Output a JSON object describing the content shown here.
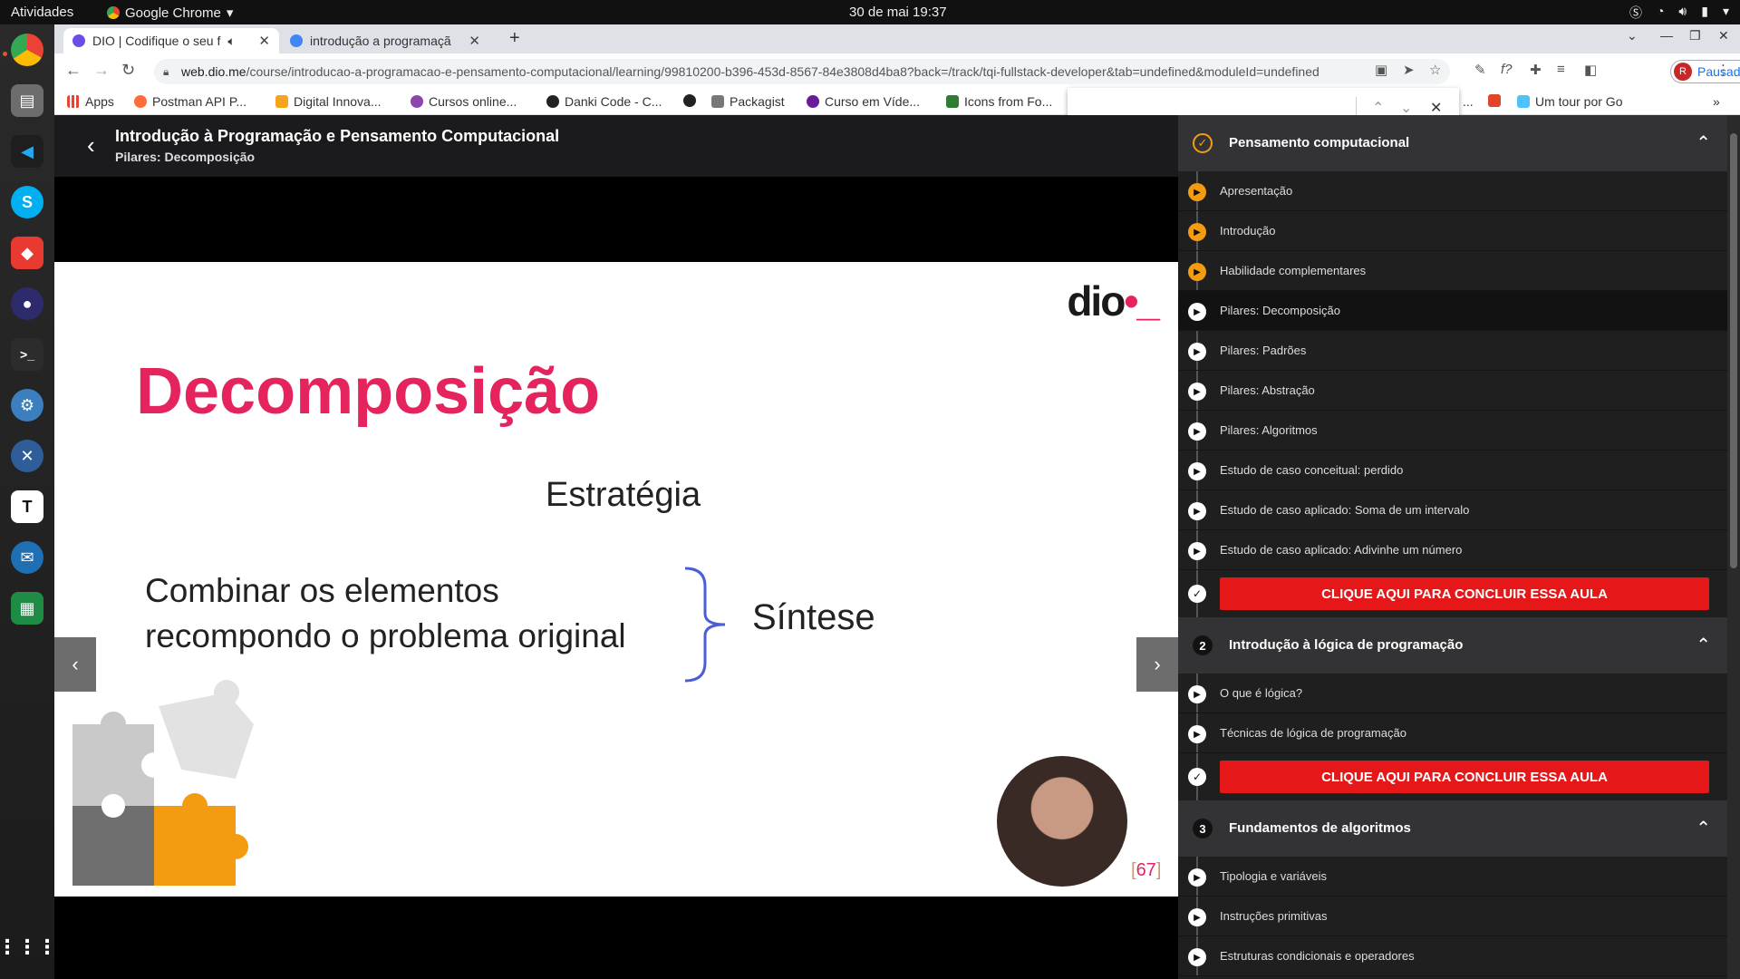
{
  "topbar": {
    "activities": "Atividades",
    "app_name": "Google Chrome",
    "clock": "30 de mai  19:37"
  },
  "tabs": [
    {
      "title": "DIO | Codifique o seu f",
      "favicon_color": "#6c4ee6"
    },
    {
      "title": "introdução a programaçã",
      "favicon_color": "#4285f4"
    }
  ],
  "toolbar": {
    "url_host": "web.dio.me",
    "url_path": "/course/introducao-a-programacao-e-pensamento-computacional/learning/99810200-b396-453d-8567-84e3808d4ba8?back=/track/tqi-fullstack-developer&tab=undefined&moduleId=undefined",
    "profile_initial": "R",
    "profile_label": "Pausada"
  },
  "bookmarks": [
    {
      "label": "Apps",
      "color": "#ea4335"
    },
    {
      "label": "Postman API P...",
      "color": "#ff6c37"
    },
    {
      "label": "Digital Innova...",
      "color": "#f7a41d"
    },
    {
      "label": "Cursos online...",
      "color": "#8e44ad"
    },
    {
      "label": "Danki Code - C...",
      "color": "#222222"
    },
    {
      "label": "",
      "color": "#222222"
    },
    {
      "label": "Packagist",
      "color": "#777777"
    },
    {
      "label": "Curso em Víde...",
      "color": "#6a1b9a"
    },
    {
      "label": "Icons from Fo...",
      "color": "#2e7d32"
    },
    {
      "label": "...",
      "color": "#ffffff"
    },
    {
      "label": "",
      "color": "#e24329"
    },
    {
      "label": "Um tour por Go",
      "color": "#4fc3f7"
    }
  ],
  "course": {
    "title": "Introdução à Programação e Pensamento Computacional",
    "lesson": "Pilares: Decomposição"
  },
  "slide": {
    "logo_text": "dio",
    "title": "Decomposição",
    "strategy": "Estratégia",
    "body_line1": "Combinar os elementos",
    "body_line2": "recompondo o problema original",
    "synthesis": "Síntese",
    "slide_number": "67"
  },
  "modules": [
    {
      "badge": "✓",
      "name": "Pensamento computacional",
      "items": [
        {
          "label": "Apresentação",
          "status": "watched"
        },
        {
          "label": "Introdução",
          "status": "watched"
        },
        {
          "label": "Habilidade complementares",
          "status": "watched"
        },
        {
          "label": "Pilares: Decomposição",
          "status": "current"
        },
        {
          "label": "Pilares: Padrões",
          "status": "pending"
        },
        {
          "label": "Pilares: Abstração",
          "status": "pending"
        },
        {
          "label": "Pilares: Algoritmos",
          "status": "pending"
        },
        {
          "label": "Estudo de caso conceitual: perdido",
          "status": "pending"
        },
        {
          "label": "Estudo de caso aplicado: Soma de um intervalo",
          "status": "pending"
        },
        {
          "label": "Estudo de caso aplicado: Adivinhe um número",
          "status": "pending"
        }
      ],
      "conclude_label": "CLIQUE AQUI PARA CONCLUIR ESSA AULA"
    },
    {
      "badge": "2",
      "name": "Introdução à lógica de programação",
      "items": [
        {
          "label": "O que é lógica?",
          "status": "pending"
        },
        {
          "label": "Técnicas de lógica de programação",
          "status": "pending"
        }
      ],
      "conclude_label": "CLIQUE AQUI PARA CONCLUIR ESSA AULA"
    },
    {
      "badge": "3",
      "name": "Fundamentos de algoritmos",
      "items": [
        {
          "label": "Tipologia e variáveis",
          "status": "pending"
        },
        {
          "label": "Instruções primitivas",
          "status": "pending"
        },
        {
          "label": "Estruturas condicionais e operadores",
          "status": "pending"
        }
      ]
    }
  ],
  "colors": {
    "accent_pink": "#e5245e",
    "conclude_red": "#e51718",
    "progress_orange": "#f39c12"
  }
}
